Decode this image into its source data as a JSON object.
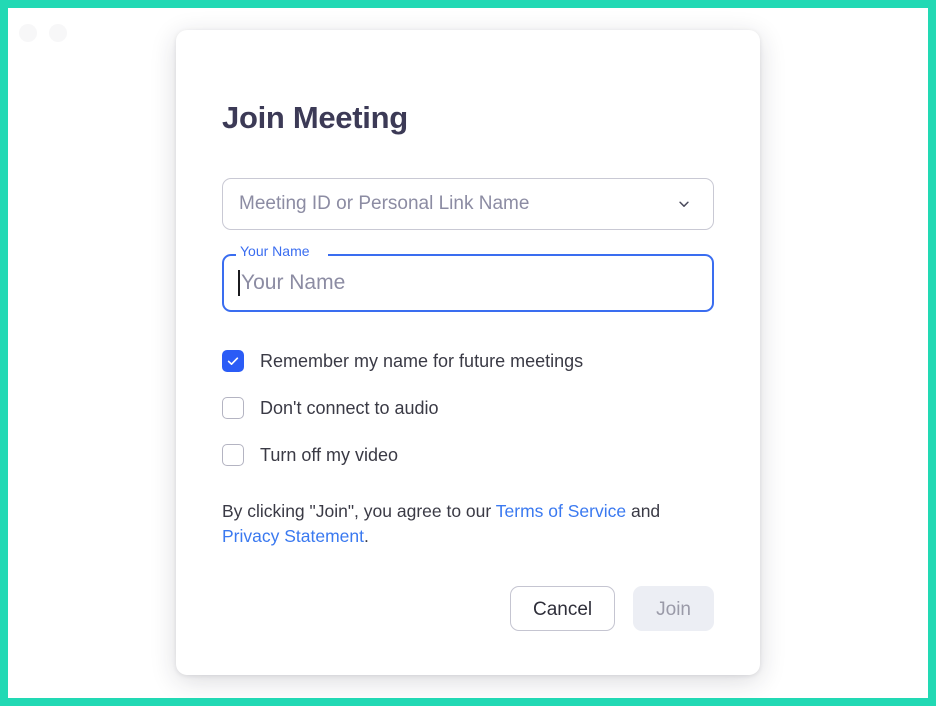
{
  "window": {
    "traffic_lights": [
      "minimize-dot",
      "maximize-dot"
    ]
  },
  "dialog": {
    "title": "Join Meeting",
    "meeting_id": {
      "value": "",
      "placeholder": "Meeting ID or Personal Link Name",
      "dropdown_icon": "chevron-down-icon"
    },
    "your_name": {
      "label": "Your Name",
      "value": "",
      "placeholder": "Your Name",
      "focused": true,
      "accent_color": "#3a6df0"
    },
    "options": [
      {
        "label": "Remember my name for future meetings",
        "checked": true
      },
      {
        "label": "Don't connect to audio",
        "checked": false
      },
      {
        "label": "Turn off my video",
        "checked": false
      }
    ],
    "legal": {
      "prefix": "By clicking \"Join\", you agree to our ",
      "terms_link": "Terms of Service",
      "middle": " and ",
      "privacy_link": "Privacy Statement",
      "suffix": "."
    },
    "buttons": {
      "cancel": "Cancel",
      "join": "Join",
      "join_disabled": true
    }
  },
  "colors": {
    "frame": "#22d9b4",
    "title": "#3c3a56",
    "link": "#3a79f0",
    "checkbox_checked": "#2b5cf6",
    "join_disabled_bg": "#eceef4",
    "join_disabled_text": "#9a9aa8"
  }
}
